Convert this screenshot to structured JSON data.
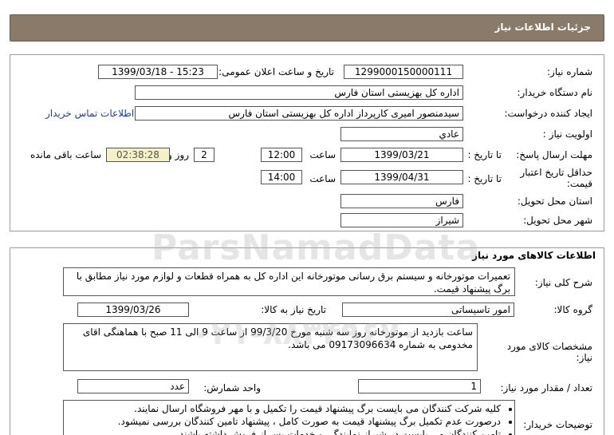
{
  "header": {
    "title": "جزئیات اطلاعات نیاز"
  },
  "details": {
    "need_number_label": "شماره نیاز:",
    "need_number": "1299000150000111",
    "announce_label": "تاریخ و ساعت اعلان عمومی:",
    "announce_value": "1399/03/18 - 15:23",
    "buyer_org_label": "نام دستگاه خریدار:",
    "buyer_org": "اداره کل بهزیستی استان فارس",
    "requester_label": "ایجاد کننده درخواست:",
    "requester": "سیدمنصور امیری کارپرداز اداره کل بهزیستی استان فارس",
    "contact_link": "اطلاعات تماس خریدار",
    "priority_label": "اولویت نیاز :",
    "priority": "عادي",
    "deadline_label": "مهلت ارسال پاسخ:",
    "to_date_label": "تا تاریخ :",
    "deadline_date": "1399/03/21",
    "time_label": "ساعت",
    "deadline_time": "12:00",
    "days_value": "2",
    "days_label": "روز و",
    "remaining_time": "02:38:28",
    "remaining_label": "ساعت باقی مانده",
    "validity_label": "حداقل تاریخ اعتبار قیمت:",
    "validity_date": "1399/04/31",
    "validity_time": "14:00",
    "province_label": "استان محل تحویل:",
    "province": "فارس",
    "city_label": "شهر محل تحویل:",
    "city": "شیراز"
  },
  "goods": {
    "section_title": "اطلاعات کالاهای مورد نیاز",
    "summary_label": "شرح کلی نیاز:",
    "summary": "تعمیرات موتورخانه و سیستم برق رسانی موتورخانه این اداره کل به همراه قطعات و لوازم مورد نیاز مطابق با برگ پیشنهاد قیمت.",
    "group_label": "گروه کالا:",
    "group": "امور تاسیساتی",
    "need_date_label": "تاریخ نیاز به کالا:",
    "need_date": "1399/03/26",
    "specs_label": "مشخصات کالای مورد نیاز:",
    "specs": "ساعت بازدید از موتورخانه روز سه شنبه مورخ 99/3/20 از ساعت 9 الی 11 صبح با هماهنگی اقای مخدومی به شماره 09173096634 می باشد.",
    "unit_label": "واحد شمارش:",
    "unit": "عدد",
    "qty_label": "تعداد / مقدار مورد نیاز:",
    "qty": "1",
    "notes_label": "توضیحات خریدار:",
    "notes": [
      "کلیه شرکت کنندگان می بایست برگ پیشنهاد قیمت را تکمیل و با مهر فروشگاه ارسال نمایند.",
      "درصورت عدم تکمیل برگ پیشنهاد قیمت به صورت کامل ، پیشنهاد تامین کنندگان بررسی نمیشود.",
      "تامین کنندگان می بایست در شیراز نمایندگی و خدمات پس از فروش داشته باشند."
    ]
  },
  "watermark": {
    "brand": "ParsNamadData",
    "phone": "۰۲۱-۸۸۳۴۹۶۷۰"
  }
}
